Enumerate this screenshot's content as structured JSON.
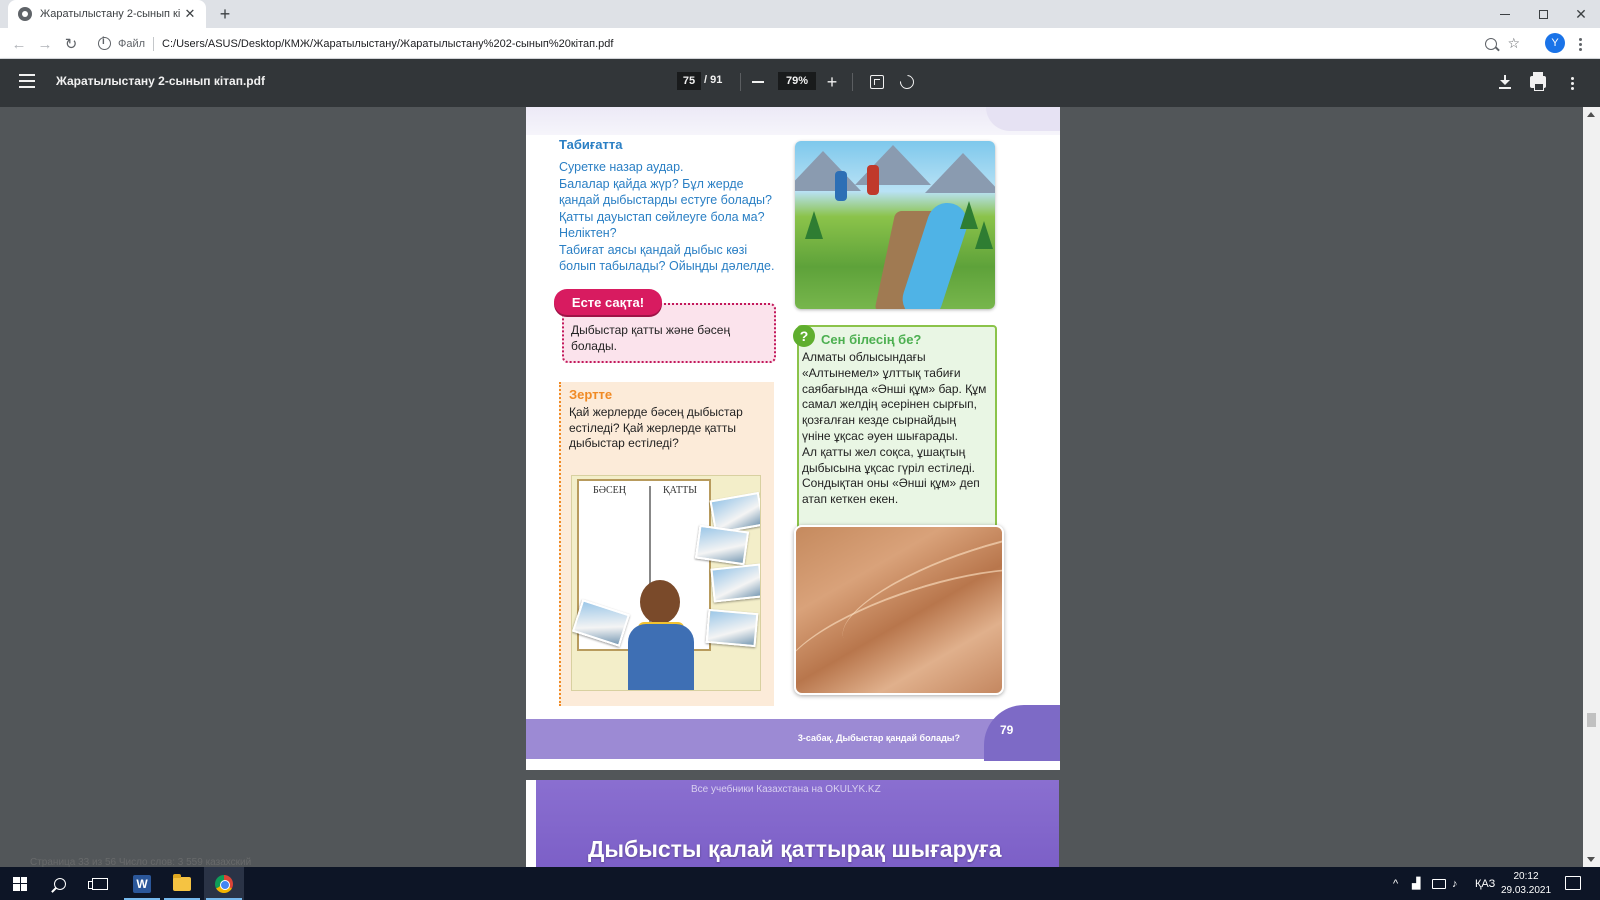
{
  "browser": {
    "tab_title": "Жаратылыстану 2-сынып кітап.pdf",
    "new_tab_symbol": "+",
    "close_symbol": "✕",
    "scheme_label": "Файл",
    "url": "C:/Users/ASUS/Desktop/КМЖ/Жаратылыстану/Жаратылыстану%202-сынып%20кітап.pdf",
    "profile_initial": "Y"
  },
  "pdf_viewer": {
    "file_title": "Жаратылыстану 2-сынып кітап.pdf",
    "current_page": "75",
    "total_pages": "/  91",
    "zoom": "79%"
  },
  "page": {
    "nature_heading": "Табиғатта",
    "nature_questions": [
      "Суретке назар аудар.",
      "Балалар қайда жүр? Бұл жерде",
      "қандай дыбыстарды естуге болады?",
      "Қатты дауыстап сөйлеуге бола ма?",
      "Неліктен?",
      "Табиғат аясы қандай дыбыс көзі",
      "болып табылады? Ойыңды дәлелде."
    ],
    "remember_label": "Есте сақта!",
    "remember_text": "Дыбыстар қатты және бәсең болады.",
    "research_title": "Зертте",
    "research_text": "Қай жерлерде бәсең дыбыстар естіледі? Қай жерлерде қатты дыбыстар естіледі?",
    "board_quiet": "БӘСЕҢ",
    "board_loud": "ҚАТТЫ",
    "did_you_know_title": "Сен білесің бе?",
    "did_you_know_lines": [
      "Алматы облысындағы",
      "«Алтынемел» ұлттық табиғи",
      "саябағында «Әнші құм» бар. Құм",
      "самал желдің әсерінен сырғып,",
      "қозғалған кезде сырнайдың",
      "үніне ұқсас әуен шығарады.",
      "Ал қатты жел соқса, ұшақтың",
      "дыбысына ұқсас гүріл естіледі.",
      "Сондықтан оны «Әнші құм» деп",
      "атап кеткен екен."
    ],
    "footer_lesson": "3-сабақ. Дыбыстар қандай болады?",
    "page_number": "79"
  },
  "next_page": {
    "watermark": "Все учебники Казахстана на OKULYK.KZ",
    "title": "Дыбысты қалай қаттырақ шығаруға"
  },
  "taskbar": {
    "ghost_status": "Страница 33 из 56    Число слов: 3 559    казахский",
    "language": "ҚАЗ",
    "time": "20:12",
    "date": "29.03.2021"
  },
  "colors": {
    "accent_blue": "#2a7fc4",
    "remember_pink": "#d81b60",
    "research_orange": "#f08a24",
    "didyouknow_green": "#5fae2e",
    "footer_purple": "#9c8ad4"
  }
}
